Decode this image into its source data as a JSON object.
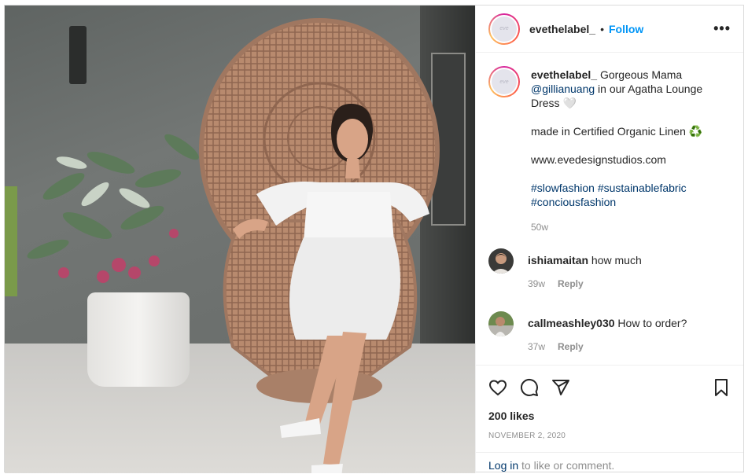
{
  "post": {
    "username": "evethelabel_",
    "separator": "•",
    "follow_label": "Follow",
    "more_label": "•••",
    "avatar_text": "eve",
    "caption": {
      "username": "evethelabel_",
      "line1_text": " Gorgeous Mama",
      "mention": "@gillianuang",
      "line2_text": " in our Agatha Lounge Dress 🤍",
      "para2": "made in Certified Organic Linen ♻️",
      "para3": "www.evedesignstudios.com",
      "hashtags": [
        "#slowfashion",
        "#sustainablefabric",
        "#conciousfashion"
      ],
      "time": "50w"
    },
    "comments": [
      {
        "username": "ishiamaitan",
        "text": " how much",
        "time": "39w",
        "reply_label": "Reply"
      },
      {
        "username": "callmeashley030",
        "text": " How to order?",
        "time": "37w",
        "reply_label": "Reply"
      }
    ],
    "likes": "200 likes",
    "date": "NOVEMBER 2, 2020",
    "login_link": "Log in",
    "login_rest": " to like or comment."
  },
  "icons": [
    "heart-icon",
    "comment-icon",
    "share-icon",
    "bookmark-icon",
    "more-icon"
  ],
  "colors": {
    "accent": "#0095f6",
    "link": "#00376b",
    "muted": "#8e8e8e"
  }
}
